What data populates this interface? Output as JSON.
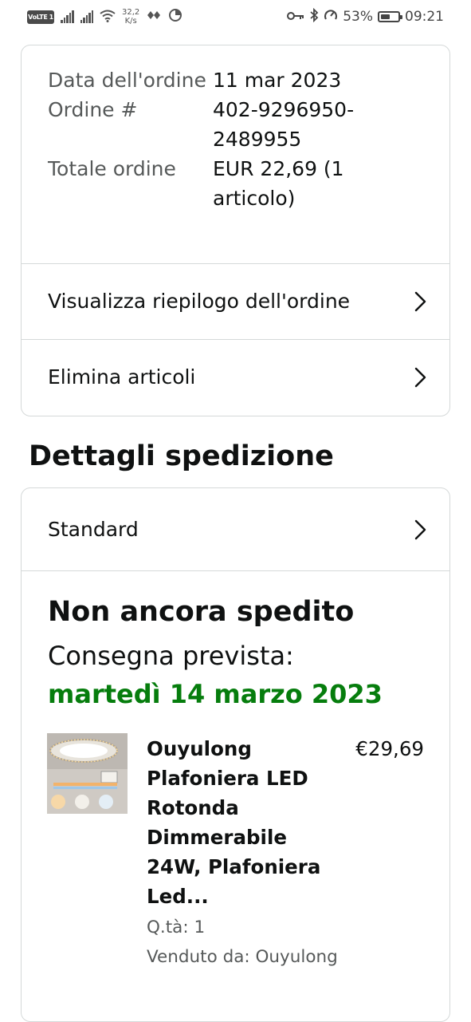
{
  "status_bar": {
    "volte": "VoLTE",
    "sim": "1",
    "speed_value": "32,2",
    "speed_unit": "K/s",
    "battery_percent_text": "53%",
    "battery_level": 0.53,
    "time": "09:21"
  },
  "order": {
    "date_label": "Data dell'ordine",
    "date_value": "11 mar 2023",
    "number_label": "Ordine #",
    "number_value": "402-9296950-2489955",
    "total_label": "Totale ordine",
    "total_value": "EUR 22,69 (1 articolo)",
    "view_summary": "Visualizza riepilogo dell'ordine",
    "delete_items": "Elimina articoli"
  },
  "shipping": {
    "section_title": "Dettagli spedizione",
    "method": "Standard",
    "status": "Non ancora spedito",
    "delivery_label": "Consegna prevista:",
    "delivery_date": "martedì 14 marzo 2023",
    "product": {
      "name": "Ouyulong Plafoniera LED Rotonda Dimmerabile 24W, Plafoniera Led...",
      "price": "€29,69",
      "quantity": "Q.tà: 1",
      "seller": "Venduto da: Ouyulong"
    }
  },
  "colors": {
    "delivery_date": "#067d0d",
    "border": "#d5d9d9",
    "secondary_text": "#565959"
  }
}
